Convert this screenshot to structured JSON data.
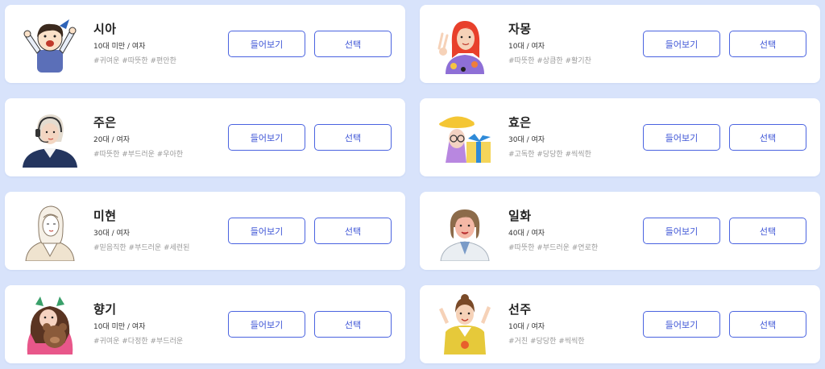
{
  "voices": [
    {
      "name": "시아",
      "meta": "10대 미만 / 여자",
      "tags": "#귀여운 #따뜻한 #편안한",
      "avatar": "child-avatar"
    },
    {
      "name": "자몽",
      "meta": "10대 / 여자",
      "tags": "#따뜻한 #상큼한 #활기찬",
      "avatar": "redhair-girl-avatar"
    },
    {
      "name": "주은",
      "meta": "20대 / 여자",
      "tags": "#따뜻한 #부드러운 #우아한",
      "avatar": "headset-woman-avatar"
    },
    {
      "name": "효은",
      "meta": "30대 / 여자",
      "tags": "#고독한 #당당한 #씩씩한",
      "avatar": "hat-woman-gift-avatar"
    },
    {
      "name": "미현",
      "meta": "30대 / 여자",
      "tags": "#믿음직한 #부드러운 #세련된",
      "avatar": "sketch-woman-avatar"
    },
    {
      "name": "일화",
      "meta": "40대 / 여자",
      "tags": "#따뜻한 #부드러운 #연로한",
      "avatar": "bob-hair-woman-avatar"
    },
    {
      "name": "향기",
      "meta": "10대 미만 / 여자",
      "tags": "#귀여운 #다정한 #부드러운",
      "avatar": "girl-teddy-avatar"
    },
    {
      "name": "선주",
      "meta": "10대 / 여자",
      "tags": "#거친 #당당한 #씩씩한",
      "avatar": "peace-sign-girl-avatar"
    }
  ],
  "buttons": {
    "listen_label": "들어보기",
    "select_label": "선택"
  },
  "colors": {
    "background": "#d8e3fb",
    "accent": "#4a63e0",
    "card": "#ffffff"
  }
}
